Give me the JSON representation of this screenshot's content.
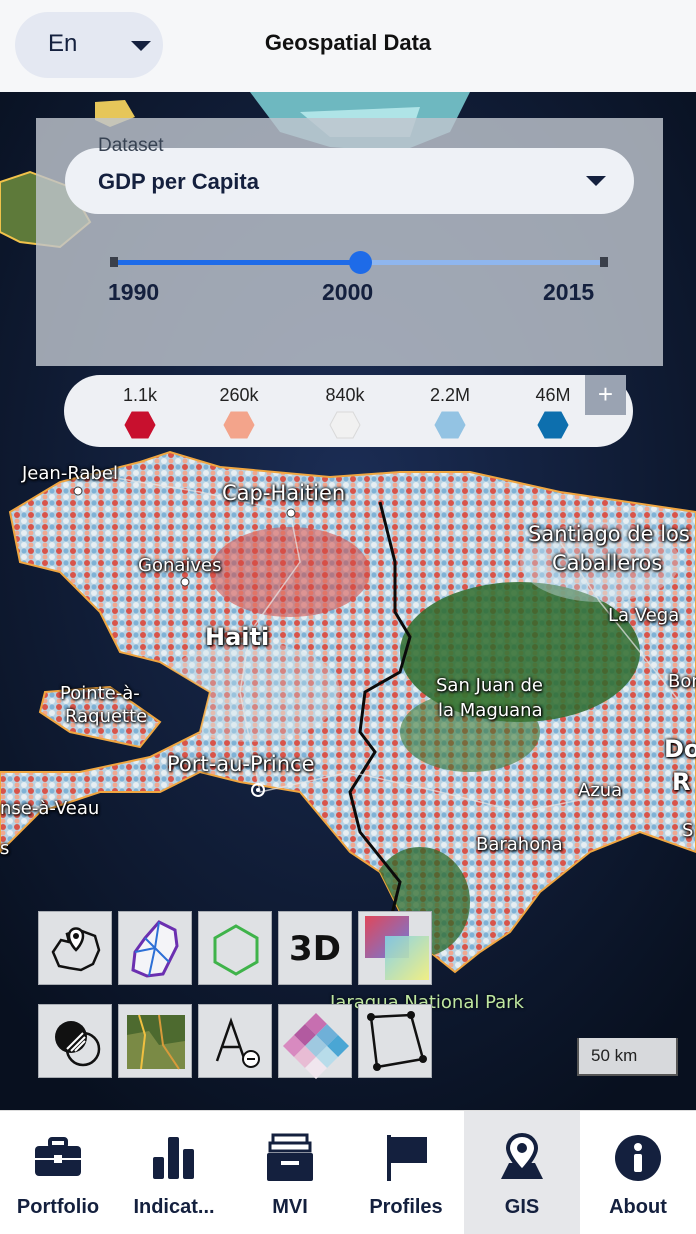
{
  "header": {
    "language": "En",
    "title": "Geospatial Data"
  },
  "dataset": {
    "label": "Dataset",
    "selected": "GDP per Capita",
    "slider": {
      "start": "1990",
      "current": "2000",
      "end": "2015",
      "position_fraction": 0.5
    }
  },
  "legend": {
    "items": [
      {
        "label": "1.1k",
        "color": "#c8102e"
      },
      {
        "label": "260k",
        "color": "#f3a48b"
      },
      {
        "label": "840k",
        "color": "#f1f1f1"
      },
      {
        "label": "2.2M",
        "color": "#93c3e3"
      },
      {
        "label": "46M",
        "color": "#0d6fae"
      }
    ],
    "add_label": "+"
  },
  "map": {
    "places": {
      "jean_rabel": "Jean-Rabel",
      "cap_haitien": "Cap-Haitien",
      "gonaives": "Gonaives",
      "haiti": "Haiti",
      "pointe_a_raquette_1": "Pointe-à-",
      "pointe_a_raquette_2": "Raquette",
      "port_au_prince": "Port-au-Prince",
      "anse_a_veau": "nse-à-Veau",
      "santiago_1": "Santiago de los",
      "santiago_2": "Caballeros",
      "la_vega": "La Vega",
      "bonao": "Bona",
      "san_juan_1": "San Juan de",
      "san_juan_2": "la Maguana",
      "santo_domingo_1": "Do",
      "santo_domingo_2": "R",
      "azua": "Azua",
      "barahona": "Barahona",
      "edge_s": "S",
      "edge_s2": "s"
    },
    "park": "Jaragua National Park",
    "scale": "50 km"
  },
  "tools": {
    "row1": [
      "location-map-icon",
      "admin-boundaries-icon",
      "hexagon-icon",
      "3d-toggle",
      "color-gradient-icon"
    ],
    "row2": [
      "layer-blend-icon",
      "satellite-icon",
      "label-toggle-icon",
      "color-scheme-icon",
      "polygon-measure-icon"
    ],
    "three_d_label": "3D"
  },
  "nav": {
    "items": [
      {
        "label": "Portfolio",
        "icon": "briefcase-icon"
      },
      {
        "label": "Indicat...",
        "icon": "bar-chart-icon"
      },
      {
        "label": "MVI",
        "icon": "file-cabinet-icon"
      },
      {
        "label": "Profiles",
        "icon": "flag-icon"
      },
      {
        "label": "GIS",
        "icon": "map-pin-icon",
        "active": true
      },
      {
        "label": "About",
        "icon": "info-icon"
      }
    ]
  }
}
